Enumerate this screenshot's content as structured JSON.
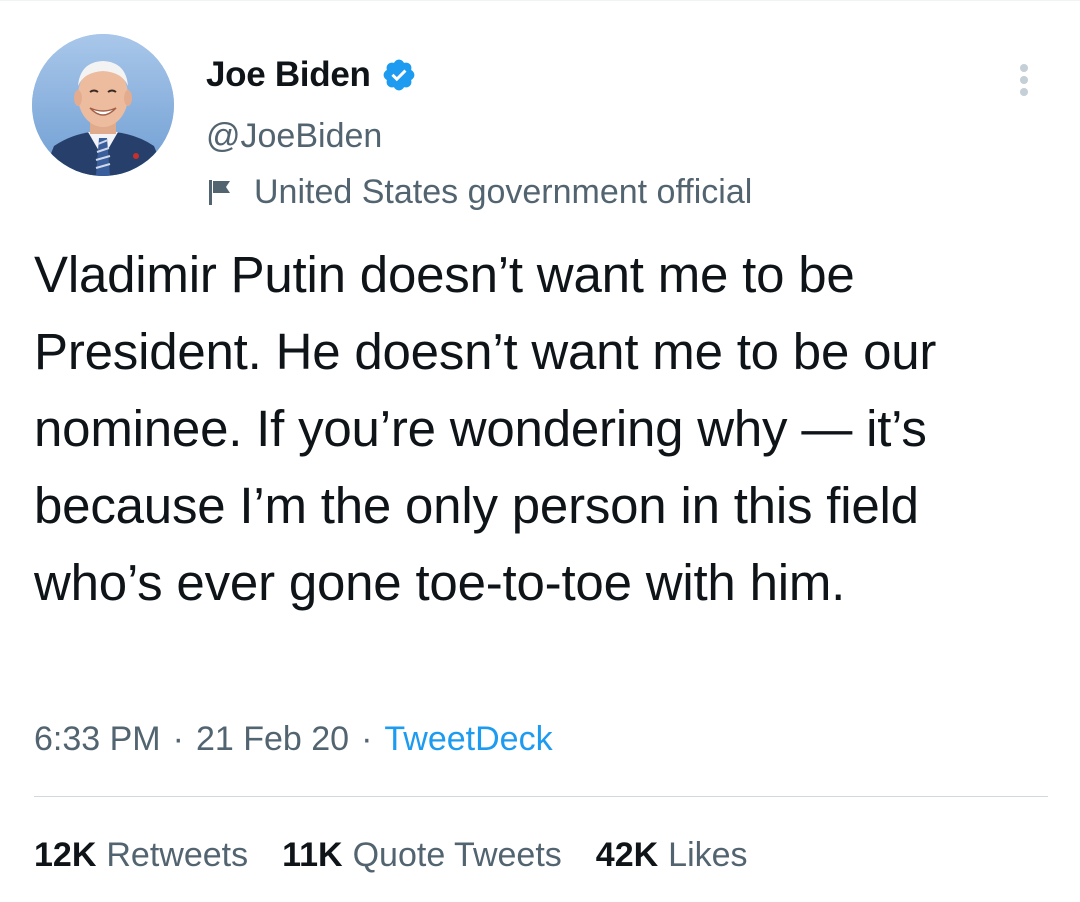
{
  "author": {
    "display_name": "Joe Biden",
    "handle": "@JoeBiden",
    "label": "United States government official",
    "verified_icon": "verified-badge-icon",
    "label_icon": "flag-icon"
  },
  "tweet": {
    "text": "Vladimir Putin doesn’t want me to be President. He doesn’t want me to be our nominee. If you’re wondering why — it’s because I’m the only person in this field who’s ever gone toe-to-toe with him."
  },
  "meta": {
    "time": "6:33 PM",
    "date": "21 Feb 20",
    "source": "TweetDeck",
    "separator": "·"
  },
  "stats": {
    "retweets_count": "12K",
    "retweets_label": "Retweets",
    "quotes_count": "11K",
    "quotes_label": "Quote Tweets",
    "likes_count": "42K",
    "likes_label": "Likes"
  },
  "colors": {
    "accent": "#1d9bf0",
    "secondary_text": "#536471",
    "primary_text": "#0f1419"
  }
}
